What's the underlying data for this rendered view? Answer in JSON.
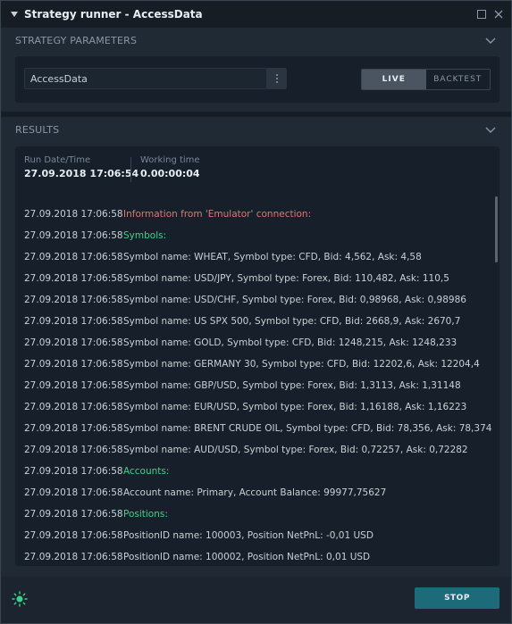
{
  "window": {
    "title": "Strategy runner - AccessData"
  },
  "strategy_parameters": {
    "header": "STRATEGY PARAMETERS",
    "strategy_name": "AccessData",
    "mode_live": "LIVE",
    "mode_backtest": "BACKTEST",
    "selected_mode": "LIVE"
  },
  "results": {
    "header": "RESULTS",
    "run_date_label": "Run Date/Time",
    "run_date_value": "27.09.2018 17:06:54",
    "working_time_label": "Working time",
    "working_time_value": "0.00:00:04",
    "log": [
      {
        "time": "27.09.2018 17:06:58",
        "message": "Information from 'Emulator' connection:",
        "style": "info"
      },
      {
        "time": "27.09.2018 17:06:58",
        "message": "Symbols:",
        "style": "green"
      },
      {
        "time": "27.09.2018 17:06:58",
        "message": "Symbol name: WHEAT, Symbol type: CFD, Bid: 4,562, Ask: 4,58",
        "style": "normal"
      },
      {
        "time": "27.09.2018 17:06:58",
        "message": "Symbol name: USD/JPY, Symbol type: Forex, Bid: 110,482, Ask: 110,5",
        "style": "normal"
      },
      {
        "time": "27.09.2018 17:06:58",
        "message": "Symbol name: USD/CHF, Symbol type: Forex, Bid: 0,98968, Ask: 0,98986",
        "style": "normal"
      },
      {
        "time": "27.09.2018 17:06:58",
        "message": "Symbol name: US SPX 500, Symbol type: CFD, Bid: 2668,9, Ask: 2670,7",
        "style": "normal"
      },
      {
        "time": "27.09.2018 17:06:58",
        "message": "Symbol name: GOLD, Symbol type: CFD, Bid: 1248,215, Ask: 1248,233",
        "style": "normal"
      },
      {
        "time": "27.09.2018 17:06:58",
        "message": "Symbol name: GERMANY 30, Symbol type: CFD, Bid: 12202,6, Ask: 12204,4",
        "style": "normal"
      },
      {
        "time": "27.09.2018 17:06:58",
        "message": "Symbol name: GBP/USD, Symbol type: Forex, Bid: 1,3113, Ask: 1,31148",
        "style": "normal"
      },
      {
        "time": "27.09.2018 17:06:58",
        "message": "Symbol name: EUR/USD, Symbol type: Forex, Bid: 1,16188, Ask: 1,16223",
        "style": "normal"
      },
      {
        "time": "27.09.2018 17:06:58",
        "message": "Symbol name: BRENT CRUDE OIL, Symbol type: CFD, Bid: 78,356, Ask: 78,374",
        "style": "normal"
      },
      {
        "time": "27.09.2018 17:06:58",
        "message": "Symbol name: AUD/USD, Symbol type: Forex, Bid: 0,72257, Ask: 0,72282",
        "style": "normal"
      },
      {
        "time": "27.09.2018 17:06:58",
        "message": "Accounts:",
        "style": "green"
      },
      {
        "time": "27.09.2018 17:06:58",
        "message": "Account name: Primary, Account Balance: 99977,75627",
        "style": "normal"
      },
      {
        "time": "27.09.2018 17:06:58",
        "message": "Positions:",
        "style": "green"
      },
      {
        "time": "27.09.2018 17:06:58",
        "message": "PositionID name: 100003, Position NetPnL: -0,01 USD",
        "style": "normal"
      },
      {
        "time": "27.09.2018 17:06:58",
        "message": "PositionID name: 100002, Position NetPnL: 0,01 USD",
        "style": "normal"
      }
    ]
  },
  "footer": {
    "stop_label": "STOP",
    "status_icon": "running-sun-icon"
  },
  "colors": {
    "accent": "#1c6a7a",
    "info_text": "#e57373",
    "section_text": "#3fd18b",
    "status_icon": "#3fd18b"
  }
}
